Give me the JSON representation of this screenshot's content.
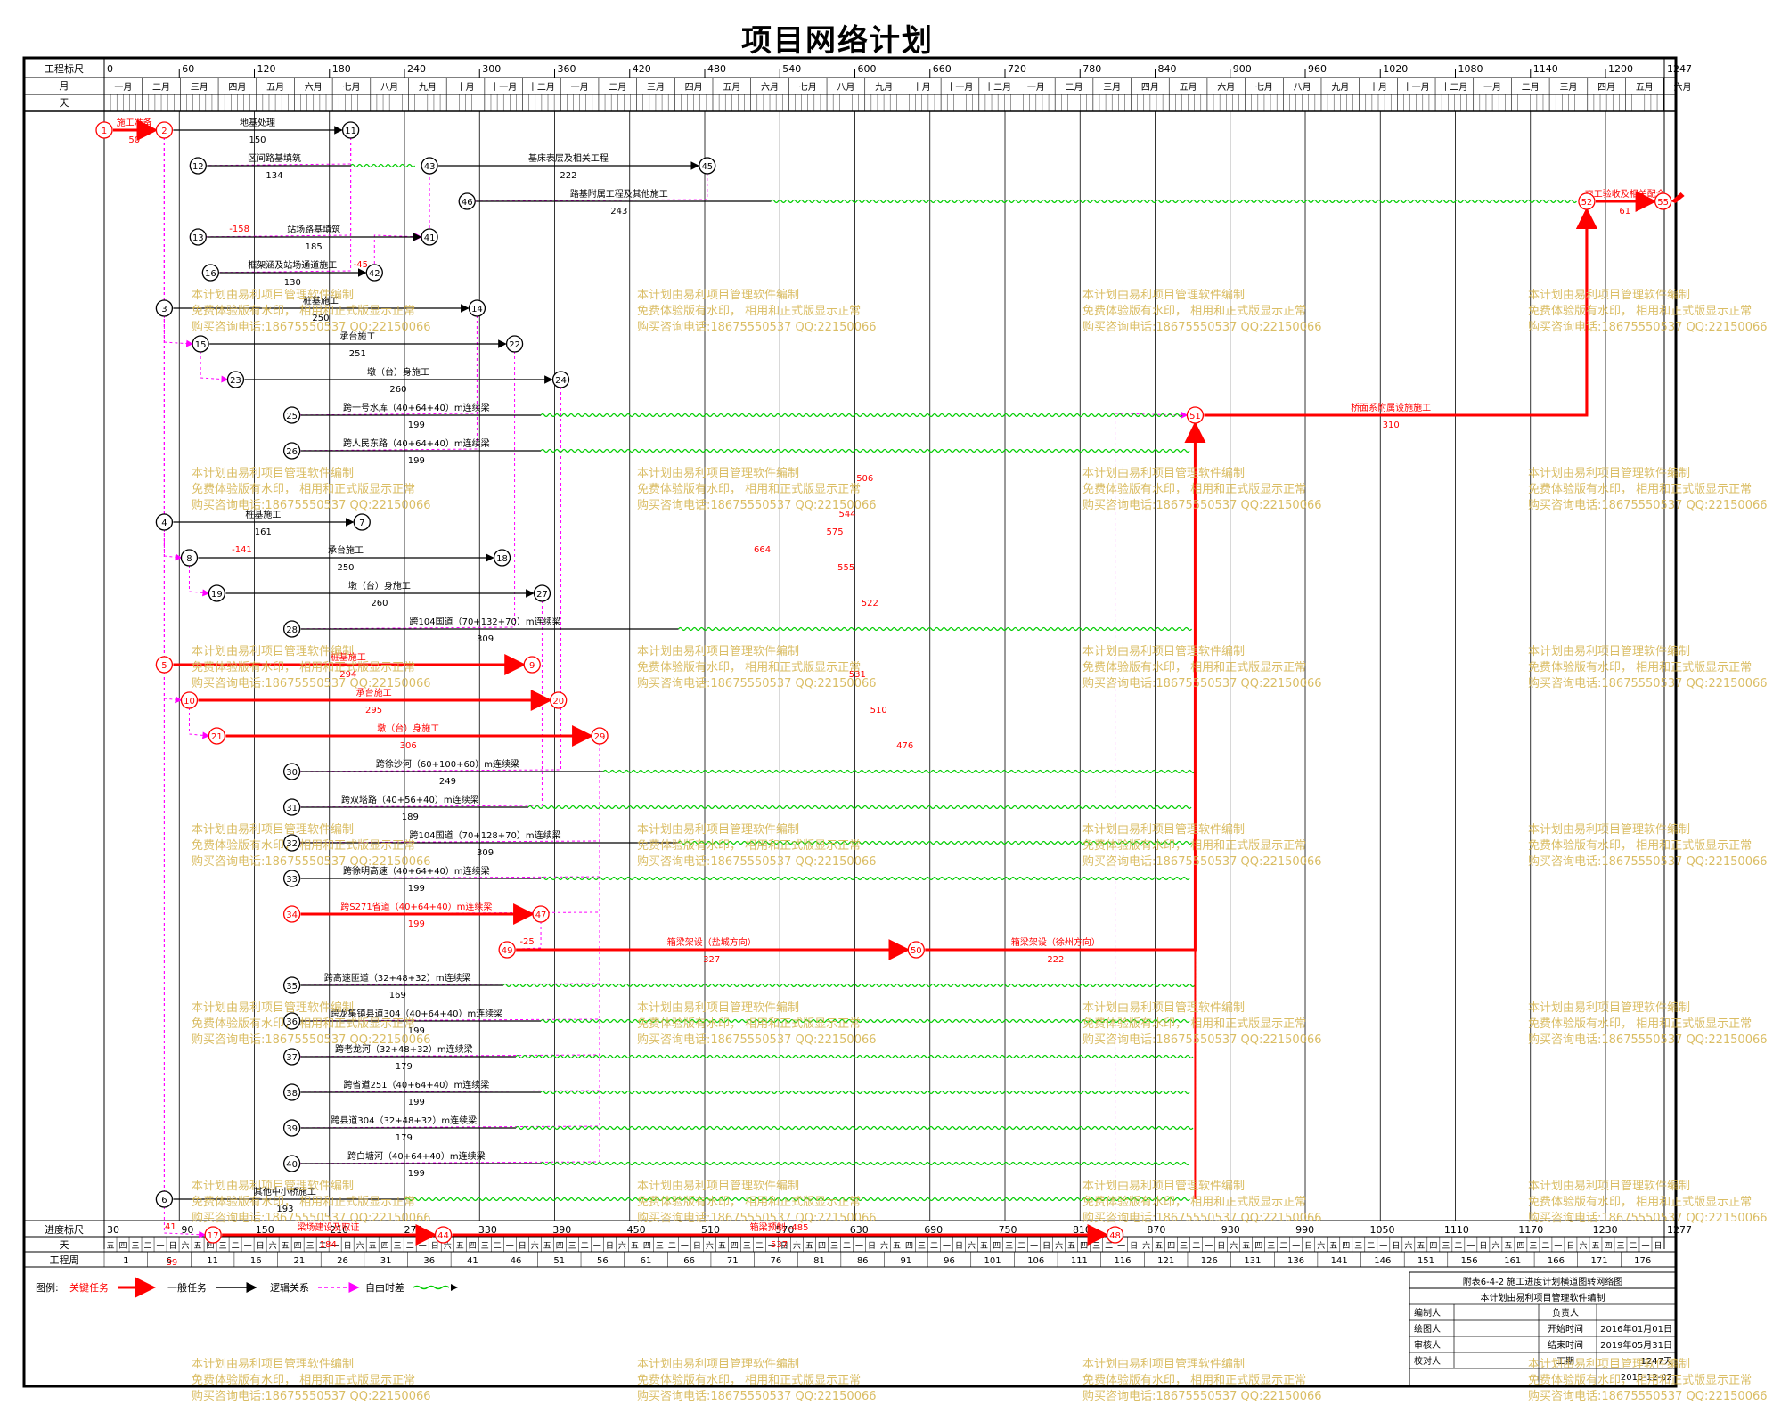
{
  "title": "项目网络计划",
  "header": {
    "scale_label": "工程标尺",
    "month_label": "月",
    "day_label": "天",
    "scale_ticks": [
      "0",
      "60",
      "120",
      "180",
      "240",
      "300",
      "360",
      "420",
      "480",
      "540",
      "600",
      "660",
      "720",
      "780",
      "840",
      "900",
      "960",
      "1020",
      "1080",
      "1140",
      "1200",
      "1247"
    ],
    "months": [
      "一月",
      "二月",
      "三月",
      "四月",
      "五月",
      "六月",
      "七月",
      "八月",
      "九月",
      "十月",
      "十一月",
      "十二月",
      "一月",
      "二月",
      "三月",
      "四月",
      "五月",
      "六月",
      "七月",
      "八月",
      "九月",
      "十月",
      "十一月",
      "十二月",
      "一月",
      "二月",
      "三月",
      "四月",
      "五月",
      "六月",
      "七月",
      "八月",
      "九月",
      "十月",
      "十一月",
      "十二月",
      "一月",
      "二月",
      "三月",
      "四月",
      "五月",
      "六月",
      "七月",
      "八月",
      "九月",
      "十月",
      "十一月",
      "十二月",
      "一月",
      "二月",
      "三月",
      "四月",
      "五月"
    ]
  },
  "footer": {
    "progress_label": "进度标尺",
    "day_label": "天",
    "week_label": "工程周",
    "progress_ticks": [
      "30",
      "90",
      "150",
      "210",
      "270",
      "330",
      "390",
      "450",
      "510",
      "570",
      "630",
      "690",
      "750",
      "810",
      "870",
      "930",
      "990",
      "1050",
      "1110",
      "1170",
      "1230",
      "1277"
    ],
    "weekdays": [
      "五",
      "四",
      "三",
      "二",
      "一",
      "日",
      "六",
      "五",
      "四",
      "三",
      "二",
      "一",
      "日",
      "六",
      "五",
      "四",
      "三",
      "二",
      "一",
      "日",
      "六"
    ],
    "week_numbers": [
      "1",
      "6",
      "11",
      "16",
      "21",
      "26",
      "31",
      "36",
      "41",
      "46",
      "51",
      "56",
      "61",
      "66",
      "71",
      "76",
      "81",
      "86",
      "91",
      "96",
      "101",
      "106",
      "111",
      "116",
      "121",
      "126",
      "131",
      "136",
      "141",
      "146",
      "151",
      "156",
      "161",
      "166",
      "171",
      "176"
    ]
  },
  "legend": {
    "label": "图例:",
    "items": [
      {
        "text": "关键任务",
        "color": "#ff0000"
      },
      {
        "text": "一般任务",
        "color": "#000000"
      },
      {
        "text": "逻辑关系",
        "color": "#ff00ff"
      },
      {
        "text": "自由时差",
        "color": "#00cc00"
      }
    ]
  },
  "info": {
    "sheet_title": "附表6-4-2   施工进度计划横道图转网络图",
    "subtitle": "本计划由易利项目管理软件编制",
    "rows": [
      {
        "k1": "编制人",
        "v1": "",
        "k2": "负责人",
        "v2": ""
      },
      {
        "k1": "绘图人",
        "v1": "",
        "k2": "开始时间",
        "v2": "2016年01月01日"
      },
      {
        "k1": "审核人",
        "v1": "",
        "k2": "结束时间",
        "v2": "2019年05月31日"
      },
      {
        "k1": "校对人",
        "v1": "",
        "k2": "工期",
        "v2": "1247天"
      },
      {
        "k1": "",
        "v1": "",
        "k2": "",
        "v2": "2015-12-02"
      }
    ]
  },
  "watermark": [
    "本计划由易利项目管理软件编制",
    "免费体验版有水印，  相用和正式版显示正常",
    "购买咨询电话:18675550537 QQ:22150066"
  ],
  "colors": {
    "critical": "#ff0000",
    "normal": "#000000",
    "logic": "#ff00ff",
    "float": "#00cc00",
    "watermark": "#d4b24a"
  },
  "network": {
    "nodes": [
      {
        "id": "1",
        "d": 0,
        "row": 0,
        "crit": true
      },
      {
        "id": "2",
        "d": 48,
        "row": 0,
        "crit": true
      },
      {
        "id": "11",
        "d": 197,
        "row": 0
      },
      {
        "id": "12",
        "d": 75,
        "row": 1
      },
      {
        "id": "43",
        "d": 260,
        "row": 1
      },
      {
        "id": "45",
        "d": 482,
        "row": 1
      },
      {
        "id": "46",
        "d": 290,
        "row": 2
      },
      {
        "id": "52",
        "d": 1185,
        "row": 2,
        "crit": true
      },
      {
        "id": "55",
        "d": 1246,
        "row": 2,
        "crit": true
      },
      {
        "id": "13",
        "d": 75,
        "row": 3
      },
      {
        "id": "41",
        "d": 260,
        "row": 3
      },
      {
        "id": "16",
        "d": 85,
        "row": 4
      },
      {
        "id": "42",
        "d": 216,
        "row": 4
      },
      {
        "id": "3",
        "d": 48,
        "row": 5
      },
      {
        "id": "14",
        "d": 298,
        "row": 5
      },
      {
        "id": "15",
        "d": 77,
        "row": 6
      },
      {
        "id": "22",
        "d": 328,
        "row": 6
      },
      {
        "id": "23",
        "d": 105,
        "row": 7
      },
      {
        "id": "24",
        "d": 365,
        "row": 7
      },
      {
        "id": "25",
        "d": 150,
        "row": 8
      },
      {
        "id": "51",
        "d": 872,
        "row": 8,
        "crit": true
      },
      {
        "id": "26",
        "d": 150,
        "row": 9
      },
      {
        "id": "4",
        "d": 48,
        "row": 11
      },
      {
        "id": "7",
        "d": 206,
        "row": 11
      },
      {
        "id": "8",
        "d": 68,
        "row": 12
      },
      {
        "id": "18",
        "d": 318,
        "row": 12
      },
      {
        "id": "19",
        "d": 90,
        "row": 13
      },
      {
        "id": "27",
        "d": 350,
        "row": 13
      },
      {
        "id": "28",
        "d": 150,
        "row": 14
      },
      {
        "id": "5",
        "d": 48,
        "row": 15,
        "crit": true
      },
      {
        "id": "9",
        "d": 342,
        "row": 15,
        "crit": true
      },
      {
        "id": "10",
        "d": 68,
        "row": 16,
        "crit": true
      },
      {
        "id": "20",
        "d": 363,
        "row": 16,
        "crit": true
      },
      {
        "id": "21",
        "d": 90,
        "row": 17,
        "crit": true
      },
      {
        "id": "29",
        "d": 396,
        "row": 17,
        "crit": true
      },
      {
        "id": "30",
        "d": 150,
        "row": 18
      },
      {
        "id": "31",
        "d": 150,
        "row": 19
      },
      {
        "id": "32",
        "d": 150,
        "row": 20
      },
      {
        "id": "33",
        "d": 150,
        "row": 21
      },
      {
        "id": "34",
        "d": 150,
        "row": 22,
        "crit": true
      },
      {
        "id": "47",
        "d": 349,
        "row": 22,
        "crit": true
      },
      {
        "id": "49",
        "d": 322,
        "row": 23,
        "crit": true
      },
      {
        "id": "50",
        "d": 649,
        "row": 23,
        "crit": true
      },
      {
        "id": "35",
        "d": 150,
        "row": 24
      },
      {
        "id": "36",
        "d": 150,
        "row": 25
      },
      {
        "id": "37",
        "d": 150,
        "row": 26
      },
      {
        "id": "38",
        "d": 150,
        "row": 27
      },
      {
        "id": "39",
        "d": 150,
        "row": 28
      },
      {
        "id": "40",
        "d": 150,
        "row": 29
      },
      {
        "id": "6",
        "d": 48,
        "row": 30
      },
      {
        "id": "17",
        "d": 87,
        "row": 31,
        "crit": true
      },
      {
        "id": "44",
        "d": 271,
        "row": 31,
        "crit": true
      },
      {
        "id": "48",
        "d": 808,
        "row": 31,
        "crit": true
      }
    ],
    "tasks": [
      {
        "from": "1",
        "to": "2",
        "name": "施工准备",
        "dur": "50",
        "crit": true
      },
      {
        "from": "2",
        "to": "11",
        "name": "地基处理",
        "dur": "150"
      },
      {
        "from": "12",
        "to": "43",
        "name": "区间路基填筑",
        "dur": "134",
        "fl": 197
      },
      {
        "from": "43",
        "to": "45",
        "name": "基床表层及相关工程",
        "dur": "222"
      },
      {
        "from": "46",
        "to": "52",
        "name": "路基附属工程及其他施工",
        "dur": "243",
        "fl": 533
      },
      {
        "from": "52",
        "to": "55",
        "name": "交工验收及相关配合",
        "dur": "61",
        "crit": true
      },
      {
        "from": "13",
        "to": "41",
        "name": "站场路基填筑",
        "dur": "185"
      },
      {
        "from": "16",
        "to": "42",
        "name": "框架涵及站场通道施工",
        "dur": "130"
      },
      {
        "from": "3",
        "to": "14",
        "name": "桩基施工",
        "dur": "250"
      },
      {
        "from": "15",
        "to": "22",
        "name": "承台施工",
        "dur": "251"
      },
      {
        "from": "23",
        "to": "24",
        "name": "墩（台）身施工",
        "dur": "260"
      },
      {
        "from": "25",
        "to": "51",
        "name": "跨一号水库（40+64+40）m连续梁",
        "dur": "199",
        "fl": 349
      },
      {
        "from": "26",
        "to": "51",
        "name": "跨人民东路（40+64+40）m连续梁",
        "dur": "199",
        "fl": 349
      },
      {
        "from": "51",
        "to": "52",
        "name": "桥面系附属设施施工",
        "dur": "310",
        "crit": true
      },
      {
        "from": "4",
        "to": "7",
        "name": "桩基施工",
        "dur": "161"
      },
      {
        "from": "8",
        "to": "18",
        "name": "承台施工",
        "dur": "250"
      },
      {
        "from": "19",
        "to": "27",
        "name": "墩（台）身施工",
        "dur": "260"
      },
      {
        "from": "28",
        "to": "51",
        "name": "跨104国道（70+132+70）m连续梁",
        "dur": "309",
        "fl": 459
      },
      {
        "from": "5",
        "to": "9",
        "name": "桩基施工",
        "dur": "294",
        "crit": true
      },
      {
        "from": "10",
        "to": "20",
        "name": "承台施工",
        "dur": "295",
        "crit": true
      },
      {
        "from": "21",
        "to": "29",
        "name": "墩（台）身施工",
        "dur": "306",
        "crit": true
      },
      {
        "from": "30",
        "to": "51",
        "name": "跨徐沙河（60+100+60）m连续梁",
        "dur": "249",
        "fl": 399
      },
      {
        "from": "31",
        "to": "51",
        "name": "跨双塔路（40+56+40）m连续梁",
        "dur": "189",
        "fl": 339
      },
      {
        "from": "32",
        "to": "51",
        "name": "跨104国道（70+128+70）m连续梁",
        "dur": "309",
        "fl": 459
      },
      {
        "from": "33",
        "to": "51",
        "name": "跨徐明高速（40+64+40）m连续梁",
        "dur": "199",
        "fl": 349
      },
      {
        "from": "34",
        "to": "47",
        "name": "跨S271省道（40+64+40）m连续梁",
        "dur": "199",
        "crit": true
      },
      {
        "from": "49",
        "to": "50",
        "name": "箱梁架设（盐城方向）",
        "dur": "327",
        "crit": true
      },
      {
        "from": "50",
        "to": "51",
        "name": "箱梁架设（徐州方向）",
        "dur": "222",
        "crit": true
      },
      {
        "from": "35",
        "to": "51",
        "name": "跨高速匝道（32+48+32）m连续梁",
        "dur": "169",
        "fl": 319
      },
      {
        "from": "36",
        "to": "51",
        "name": "跨龙集镇县道304（40+64+40）m连续梁",
        "dur": "199",
        "fl": 349
      },
      {
        "from": "37",
        "to": "51",
        "name": "跨老龙河（32+48+32）m连续梁",
        "dur": "179",
        "fl": 329
      },
      {
        "from": "38",
        "to": "51",
        "name": "跨省道251（40+64+40）m连续梁",
        "dur": "199",
        "fl": 349
      },
      {
        "from": "39",
        "to": "51",
        "name": "跨县道304（32+48+32）m连续梁",
        "dur": "179",
        "fl": 329
      },
      {
        "from": "40",
        "to": "51",
        "name": "跨白塘河（40+64+40）m连续梁",
        "dur": "199",
        "fl": 349
      },
      {
        "from": "6",
        "to": "51",
        "name": "其他中小桥施工",
        "dur": "193",
        "fl": 241
      },
      {
        "from": "17",
        "to": "44",
        "name": "梁场建设及取证",
        "dur": "184",
        "crit": true
      },
      {
        "from": "44",
        "to": "48",
        "name": "箱梁预制 -485",
        "dur": "537",
        "crit": true
      }
    ],
    "logic": [
      [
        "2",
        "3"
      ],
      [
        "2",
        "4"
      ],
      [
        "2",
        "5"
      ],
      [
        "2",
        "6"
      ],
      [
        "11",
        "12"
      ],
      [
        "11",
        "13"
      ],
      [
        "11",
        "16"
      ],
      [
        "42",
        "41"
      ],
      [
        "41",
        "43"
      ],
      [
        "45",
        "46"
      ],
      [
        "3",
        "15"
      ],
      [
        "15",
        "23"
      ],
      [
        "4",
        "8"
      ],
      [
        "8",
        "19"
      ],
      [
        "5",
        "10"
      ],
      [
        "10",
        "21"
      ],
      [
        "14",
        "25"
      ],
      [
        "14",
        "26"
      ],
      [
        "22",
        "28"
      ],
      [
        "24",
        "30"
      ],
      [
        "27",
        "31"
      ],
      [
        "29",
        "32"
      ],
      [
        "29",
        "33"
      ],
      [
        "29",
        "34"
      ],
      [
        "47",
        "49"
      ],
      [
        "29",
        "35"
      ],
      [
        "29",
        "36"
      ],
      [
        "29",
        "37"
      ],
      [
        "29",
        "38"
      ],
      [
        "29",
        "39"
      ],
      [
        "29",
        "40"
      ],
      [
        "2",
        "17"
      ],
      [
        "48",
        "51"
      ]
    ],
    "negatives": [
      {
        "text": "-158",
        "d": 108,
        "row": 3
      },
      {
        "text": "-45",
        "d": 205,
        "row": 4
      },
      {
        "text": "-141",
        "d": 110,
        "row": 12
      },
      {
        "text": "-25",
        "d": 338,
        "row": 23
      },
      {
        "text": "41",
        "d": 53,
        "row": 31
      },
      {
        "text": "39",
        "d": 54,
        "row": 32
      },
      {
        "text": "506",
        "d": 608,
        "row": 10
      },
      {
        "text": "544",
        "d": 594,
        "row": 11
      },
      {
        "text": "575",
        "d": 584,
        "row": 11.5
      },
      {
        "text": "664",
        "d": 526,
        "row": 12
      },
      {
        "text": "555",
        "d": 593,
        "row": 12.5
      },
      {
        "text": "522",
        "d": 612,
        "row": 13.5
      },
      {
        "text": "531",
        "d": 602,
        "row": 15.5
      },
      {
        "text": "510",
        "d": 619,
        "row": 16.5
      },
      {
        "text": "476",
        "d": 640,
        "row": 17.5
      }
    ]
  }
}
